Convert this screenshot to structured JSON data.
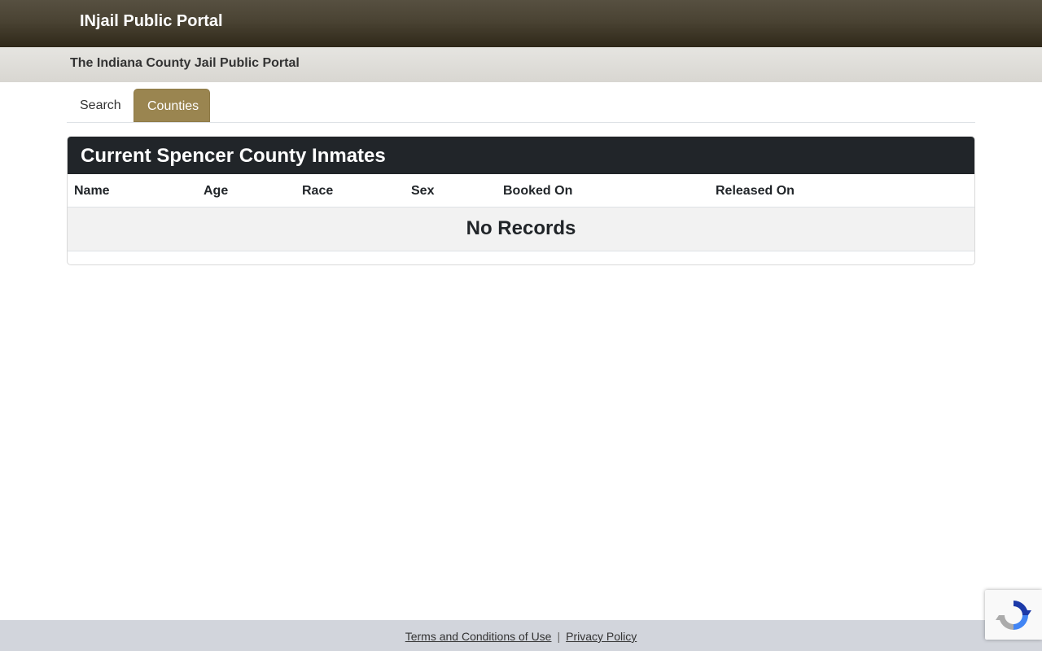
{
  "navbar": {
    "brand": "INjail Public Portal"
  },
  "subheader": {
    "title": "The Indiana County Jail Public Portal"
  },
  "tabs": [
    {
      "label": "Search",
      "active": false
    },
    {
      "label": "Counties",
      "active": true
    }
  ],
  "inmates": {
    "title": "Current Spencer County Inmates",
    "columns": [
      "Name",
      "Age",
      "Race",
      "Sex",
      "Booked On",
      "Released On"
    ],
    "rows": [],
    "empty_message": "No Records"
  },
  "footer": {
    "terms_label": "Terms and Conditions of Use",
    "separator": "|",
    "privacy_label": "Privacy Policy"
  },
  "icons": {
    "recaptcha": "recaptcha-icon"
  },
  "colors": {
    "navbar_dark": "#2f2819",
    "accent_tab": "#9a8550",
    "card_header": "#212529",
    "footer": "#d2d5dc"
  }
}
